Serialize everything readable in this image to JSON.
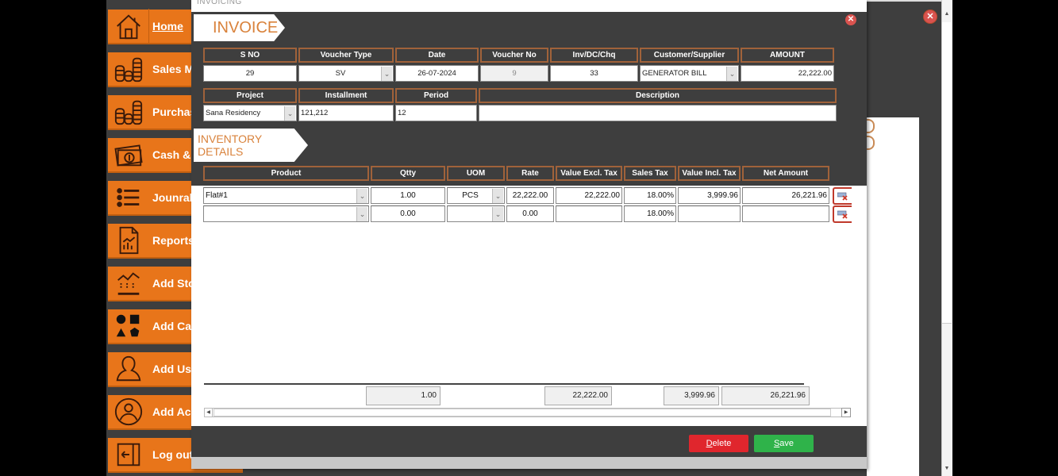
{
  "background_window": {
    "close_icon": "✕"
  },
  "sidebar": {
    "items": [
      {
        "label": "Home",
        "icon": "home-icon"
      },
      {
        "label": "Sales M",
        "icon": "coins-stack-icon"
      },
      {
        "label": "Purchase",
        "icon": "coins-stack-icon"
      },
      {
        "label": "Cash &",
        "icon": "cash-money-icon"
      },
      {
        "label": "Jounral",
        "icon": "list-icon"
      },
      {
        "label": "Reports",
        "icon": "report-chart-icon"
      },
      {
        "label": "Add Sto",
        "icon": "stock-trend-icon"
      },
      {
        "label": "Add Cat",
        "icon": "shapes-icon"
      },
      {
        "label": "Add Us",
        "icon": "user-icon"
      },
      {
        "label": "Add Ac",
        "icon": "account-circle-icon"
      },
      {
        "label": "Log out",
        "icon": "logout-icon"
      }
    ]
  },
  "dialog": {
    "title": "INVOICING",
    "close_icon": "✕",
    "banner": "INVOICE",
    "header_fields": {
      "sno": {
        "label": "S NO",
        "value": "29"
      },
      "voucher_type": {
        "label": "Voucher Type",
        "value": "SV"
      },
      "date": {
        "label": "Date",
        "value": "26-07-2024"
      },
      "voucher_no": {
        "label": "Voucher No",
        "value": "9"
      },
      "inv_dc_chq": {
        "label": "Inv/DC/Chq",
        "value": "33"
      },
      "customer_supplier": {
        "label": "Customer/Supplier",
        "value": "GENERATOR BILL"
      },
      "amount": {
        "label": "AMOUNT",
        "value": "22,222.00"
      },
      "project": {
        "label": "Project",
        "value": "Sana Residency"
      },
      "installment": {
        "label": "Installment",
        "value": "121,212"
      },
      "period": {
        "label": "Period",
        "value": "12"
      },
      "description": {
        "label": "Description",
        "value": ""
      }
    },
    "inventory_banner": "INVENTORY DETAILS",
    "columns": [
      "Product",
      "Qtty",
      "UOM",
      "Rate",
      "Value Excl. Tax",
      "Sales Tax",
      "Value Incl. Tax",
      "Net Amount"
    ],
    "rows": [
      {
        "product": "Flat#1",
        "qtty": "1.00",
        "uom": "PCS",
        "rate": "22,222.00",
        "value_excl": "22,222.00",
        "sales_tax": "18.00%",
        "value_incl": "3,999.96",
        "net_amount": "26,221.96"
      },
      {
        "product": "",
        "qtty": "0.00",
        "uom": "",
        "rate": "0.00",
        "value_excl": "",
        "sales_tax": "18.00%",
        "value_incl": "",
        "net_amount": ""
      }
    ],
    "totals": {
      "qtty": "1.00",
      "value_excl": "22,222.00",
      "value_incl": "3,999.96",
      "net_amount": "26,221.96"
    },
    "buttons": {
      "delete_mnemonic": "D",
      "delete_rest": "elete",
      "save_mnemonic": "S",
      "save_rest": "ave"
    }
  }
}
